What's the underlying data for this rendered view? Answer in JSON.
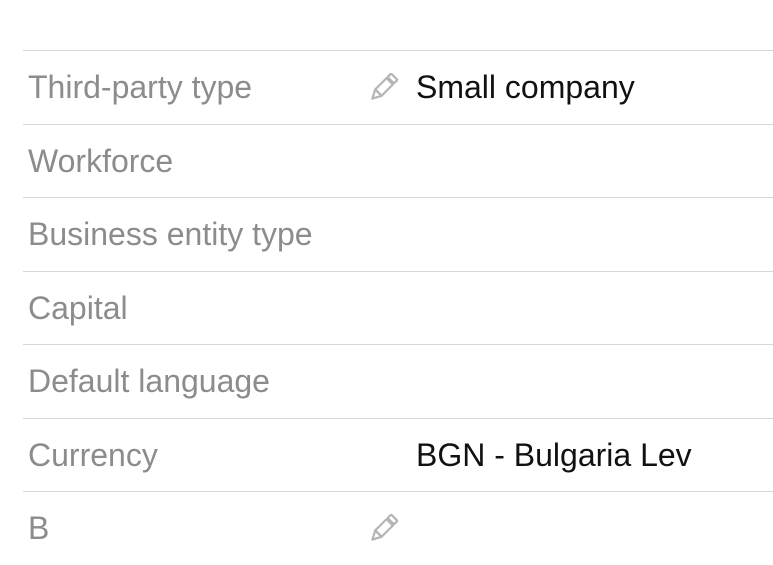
{
  "fields": [
    {
      "label": "Third-party type",
      "value": "Small company",
      "editable": true,
      "icon": "pencil-icon"
    },
    {
      "label": "Workforce",
      "value": ""
    },
    {
      "label": "Business entity type",
      "value": ""
    },
    {
      "label": "Capital",
      "value": ""
    },
    {
      "label": "Default language",
      "value": ""
    },
    {
      "label": "Currency",
      "value": "BGN - Bulgaria Lev"
    },
    {
      "label": "B",
      "value": "",
      "editable": true,
      "icon": "pencil-icon"
    }
  ],
  "colors": {
    "label": "#8c8c8c",
    "value": "#111111",
    "divider": "#d6d6d6",
    "icon": "#b5b5b5"
  }
}
